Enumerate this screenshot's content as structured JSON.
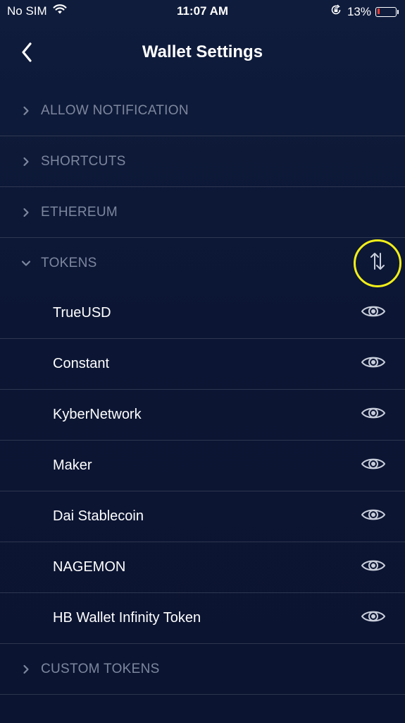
{
  "status_bar": {
    "carrier": "No SIM",
    "time": "11:07 AM",
    "battery_percent": "13%",
    "battery_level": 0.13,
    "icons": [
      "wifi-icon",
      "rotation-lock-icon",
      "battery-icon"
    ]
  },
  "header": {
    "title": "Wallet Settings",
    "back_icon": "chevron-left-icon"
  },
  "sections": {
    "allow_notification": {
      "label": "ALLOW NOTIFICATION",
      "expanded": false
    },
    "shortcuts": {
      "label": "SHORTCUTS",
      "expanded": false
    },
    "ethereum": {
      "label": "ETHEREUM",
      "expanded": false
    },
    "tokens": {
      "label": "TOKENS",
      "expanded": true,
      "action_icon": "sort-arrows-icon"
    },
    "custom_tokens": {
      "label": "CUSTOM TOKENS",
      "expanded": false
    }
  },
  "tokens": [
    {
      "name": "TrueUSD",
      "icon": "eye-icon"
    },
    {
      "name": "Constant",
      "icon": "eye-icon"
    },
    {
      "name": "KyberNetwork",
      "icon": "eye-icon"
    },
    {
      "name": "Maker",
      "icon": "eye-icon"
    },
    {
      "name": "Dai Stablecoin",
      "icon": "eye-icon"
    },
    {
      "name": "NAGEMON",
      "icon": "eye-icon"
    },
    {
      "name": "HB Wallet Infinity Token",
      "icon": "eye-icon"
    }
  ],
  "colors": {
    "background": "#0f1c3c",
    "section_text": "#7d879e",
    "token_text": "#ffffff",
    "highlight_ring": "#f2ef18",
    "battery_low": "#ff3b30"
  }
}
